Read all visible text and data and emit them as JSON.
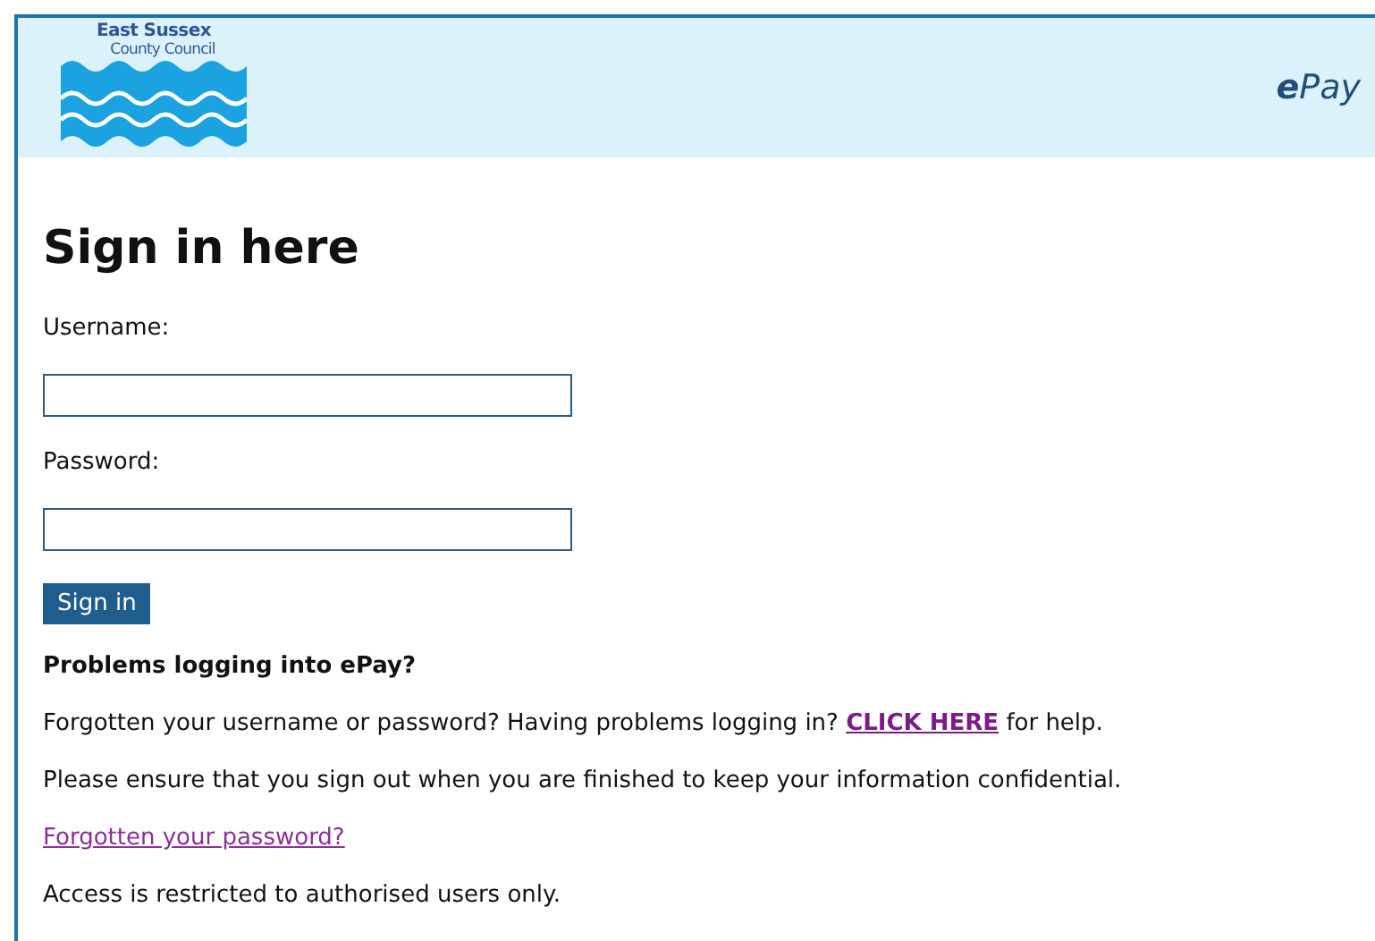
{
  "header": {
    "logo_line1": "East Sussex",
    "logo_line2": "County Council",
    "brand_prefix": "e",
    "brand_rest": "Pay"
  },
  "title": "Sign in here",
  "fields": [
    {
      "label": "Username:"
    },
    {
      "label": "Password:"
    }
  ],
  "submit": "Sign in",
  "help_heading": "Problems logging into ePay?",
  "help_text": {
    "before": "Forgotten your username or password? Having problems logging in?",
    "link": "CLICK HERE",
    "after": "for help."
  },
  "notice": "Please ensure that you sign out when you are finished to keep your information confidential.",
  "forgot_link": "Forgotten your password?",
  "footer_note": "Access is restricted to authorised users only."
}
